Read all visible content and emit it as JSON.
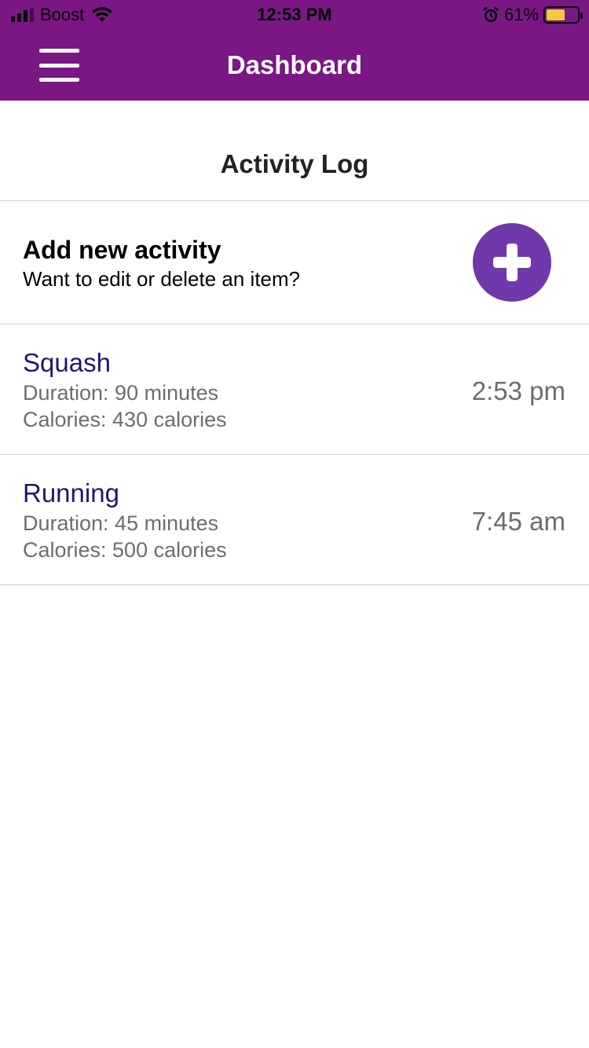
{
  "status_bar": {
    "carrier": "Boost",
    "time": "12:53 PM",
    "battery_percent": "61%",
    "battery_level": 0.61,
    "icons": [
      "signal-icon",
      "wifi-icon",
      "alarm-icon",
      "battery-icon"
    ]
  },
  "header": {
    "title": "Dashboard",
    "menu_icon": "hamburger-menu-icon",
    "background_color": "#7a1784"
  },
  "section": {
    "title": "Activity Log"
  },
  "add_activity": {
    "title": "Add new activity",
    "subtitle": "Want to edit or delete an item?",
    "button_icon": "plus-icon",
    "button_color": "#7038aa"
  },
  "activities": [
    {
      "name": "Squash",
      "duration": "Duration: 90 minutes",
      "calories": "Calories: 430 calories",
      "time": "2:53 pm"
    },
    {
      "name": "Running",
      "duration": "Duration: 45 minutes",
      "calories": "Calories: 500 calories",
      "time": "7:45 am"
    }
  ]
}
